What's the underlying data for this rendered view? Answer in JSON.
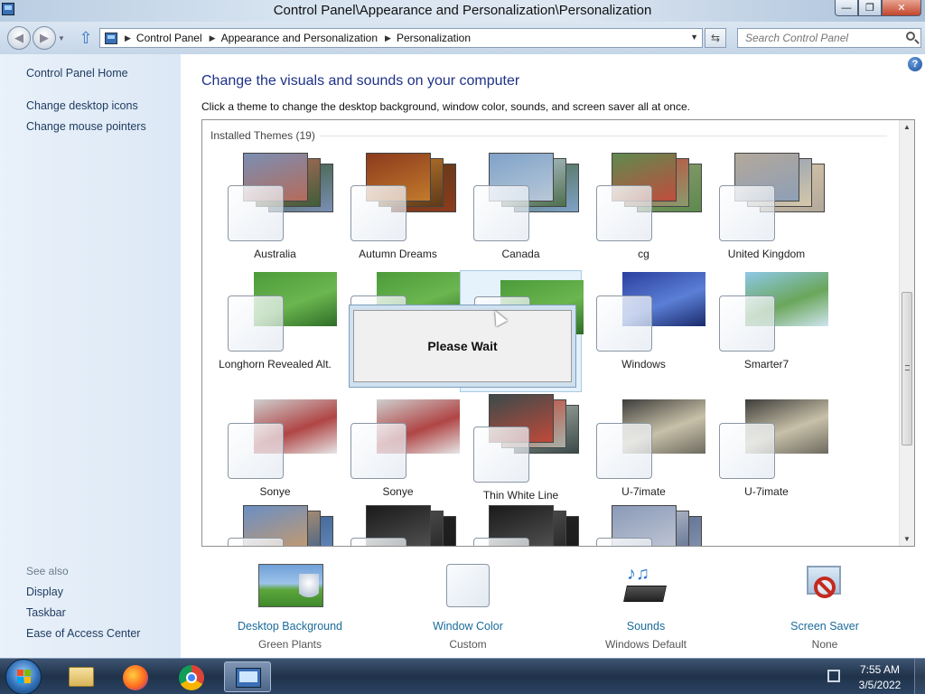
{
  "window": {
    "title": "Control Panel\\Appearance and Personalization\\Personalization",
    "minimize_glyph": "—",
    "maximize_glyph": "❐",
    "close_glyph": "✕"
  },
  "address": {
    "crumbs": [
      "Control Panel",
      "Appearance and Personalization",
      "Personalization"
    ],
    "search_placeholder": "Search Control Panel"
  },
  "left_pane": {
    "links": [
      "Control Panel Home",
      "Change desktop icons",
      "Change mouse pointers"
    ],
    "see_also_label": "See also",
    "see_also": [
      "Display",
      "Taskbar",
      "Ease of Access Center"
    ]
  },
  "main": {
    "help": "?",
    "title": "Change the visuals and sounds on your computer",
    "description": "Click a theme to change the desktop background, window color, sounds, and screen saver all at once.",
    "installed_label": "Installed Themes (19)",
    "themes": [
      {
        "name": "Australia",
        "colors": [
          "#7a8fb4",
          "#b56b5a",
          "#3f5d3a"
        ]
      },
      {
        "name": "Autumn Dreams",
        "colors": [
          "#8c3b1d",
          "#c27a2c",
          "#5d3a1a"
        ]
      },
      {
        "name": "Canada",
        "colors": [
          "#7fa2c9",
          "#b8c8d8",
          "#4f6f4d"
        ]
      },
      {
        "name": "cg",
        "colors": [
          "#5e8a4f",
          "#c14d3d",
          "#8a9a6d"
        ]
      },
      {
        "name": "United Kingdom",
        "colors": [
          "#b3a89b",
          "#8e9fb6",
          "#d6c7a8"
        ]
      },
      {
        "name": "Longhorn Revealed Alt.",
        "colors": [
          "#4c9a3b",
          "#6bb64f",
          "#2f6d28"
        ]
      },
      {
        "name": "",
        "colors": [
          "#4c9a3b",
          "#6bb64f",
          "#2f6d28"
        ]
      },
      {
        "name": "",
        "colors": [
          "#4c9a3b",
          "#6bb64f",
          "#2f6d28"
        ]
      },
      {
        "name": "Windows",
        "colors": [
          "#2b3f9e",
          "#5b7fd6",
          "#1a2a6b"
        ]
      },
      {
        "name": "Smarter7",
        "colors": [
          "#8ec8e8",
          "#6aa65a",
          "#cfe5f0"
        ]
      },
      {
        "name": "Sonye",
        "colors": [
          "#cfcfcf",
          "#b04545",
          "#e6e6e6"
        ]
      },
      {
        "name": "Sonye",
        "colors": [
          "#cfcfcf",
          "#b04545",
          "#e6e6e6"
        ]
      },
      {
        "name": "Thin White Line",
        "colors": [
          "#3b4a4a",
          "#c14a3a",
          "#a7b0a7"
        ]
      },
      {
        "name": "U-7imate",
        "colors": [
          "#3d3d3a",
          "#c8c0a8",
          "#6d6a60"
        ]
      },
      {
        "name": "U-7imate",
        "colors": [
          "#3d3d3a",
          "#c8c0a8",
          "#6d6a60"
        ]
      },
      {
        "name": "",
        "colors": [
          "#6a8fc4",
          "#c99a6a",
          "#3a5f8a"
        ]
      },
      {
        "name": "",
        "colors": [
          "#1a1a1a",
          "#555555",
          "#222222"
        ]
      },
      {
        "name": "",
        "colors": [
          "#1a1a1a",
          "#555555",
          "#222222"
        ]
      },
      {
        "name": "",
        "colors": [
          "#8a9ab8",
          "#c2c8d6",
          "#5a6a8a"
        ]
      }
    ],
    "please_wait": "Please Wait"
  },
  "bottom": {
    "items": [
      {
        "label": "Desktop Background",
        "value": "Green Plants"
      },
      {
        "label": "Window Color",
        "value": "Custom"
      },
      {
        "label": "Sounds",
        "value": "Windows Default"
      },
      {
        "label": "Screen Saver",
        "value": "None"
      }
    ]
  },
  "taskbar": {
    "time": "7:55 AM",
    "date": "3/5/2022"
  },
  "colors": {
    "link": "#1e3a5f",
    "title": "#1e3287",
    "bottom_link": "#1b6b9a"
  }
}
